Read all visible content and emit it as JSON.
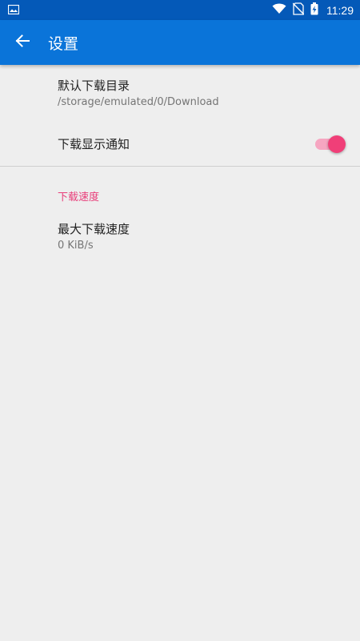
{
  "status_bar": {
    "time": "11:29",
    "icons": [
      "image-notification-icon",
      "wifi-icon",
      "no-sim-icon",
      "battery-charging-icon"
    ]
  },
  "app_bar": {
    "title": "设置",
    "back_icon": "arrow-back-icon",
    "color": "#0a74d9"
  },
  "preferences": {
    "download_dir": {
      "title": "默认下载目录",
      "summary": "/storage/emulated/0/Download"
    },
    "notification": {
      "title": "下载显示通知",
      "enabled": true
    },
    "speed_category": {
      "label": "下载速度"
    },
    "max_speed": {
      "title": "最大下载速度",
      "summary": "0 KiB/s"
    }
  },
  "colors": {
    "accent": "#f03f78",
    "status_bar": "#0459b8"
  }
}
